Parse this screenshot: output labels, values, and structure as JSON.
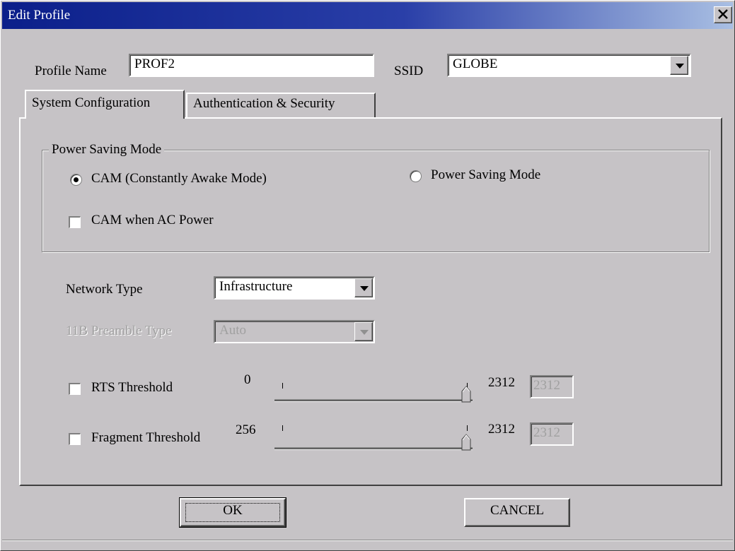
{
  "window": {
    "title": "Edit Profile"
  },
  "profile": {
    "label": "Profile Name",
    "value": "PROF2"
  },
  "ssid": {
    "label": "SSID",
    "value": "GLOBE"
  },
  "tabs": [
    {
      "label": "System Configuration",
      "active": true
    },
    {
      "label": "Authentication & Security",
      "active": false
    }
  ],
  "power_saving": {
    "group_label": "Power Saving Mode",
    "cam_label": "CAM (Constantly Awake Mode)",
    "cam_selected": true,
    "psm_label": "Power Saving Mode",
    "psm_selected": false,
    "cam_ac_label": "CAM when AC Power",
    "cam_ac_checked": false
  },
  "network_type": {
    "label": "Network Type",
    "value": "Infrastructure"
  },
  "preamble": {
    "label": "11B Preamble Type",
    "value": "Auto",
    "enabled": false
  },
  "rts": {
    "label": "RTS Threshold",
    "checked": false,
    "min": "0",
    "max": "2312",
    "value": "2312"
  },
  "fragment": {
    "label": "Fragment Threshold",
    "checked": false,
    "min": "256",
    "max": "2312",
    "value": "2312"
  },
  "buttons": {
    "ok": "OK",
    "cancel": "CANCEL"
  }
}
